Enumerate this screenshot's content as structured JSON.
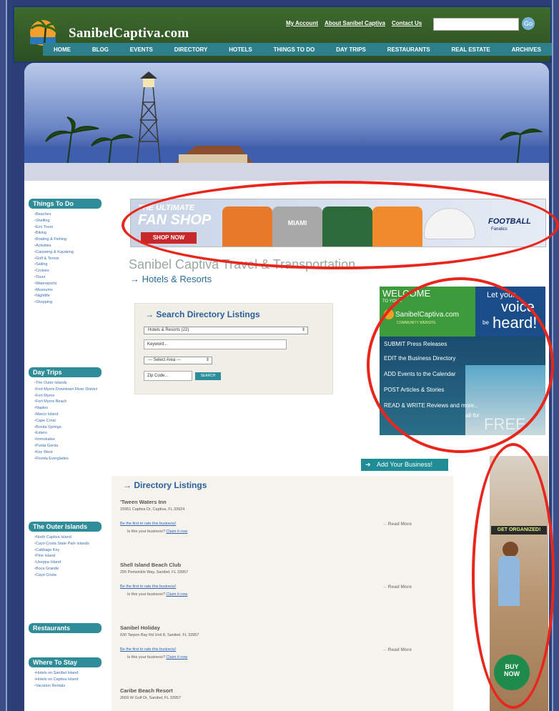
{
  "header": {
    "site_name": "SanibelCaptiva.com",
    "links": [
      "My Account",
      "About Sanibel Captiva",
      "Contact Us"
    ],
    "search_value": "",
    "search_button": "Go"
  },
  "nav": {
    "items": [
      "HOME",
      "BLOG",
      "EVENTS",
      "DIRECTORY",
      "HOTELS",
      "THINGS TO DO",
      "DAY TRIPS",
      "RESTAURANTS",
      "REAL ESTATE",
      "ARCHIVES"
    ]
  },
  "sidebar": {
    "things_to_do": {
      "title": "Things To Do",
      "items": [
        "Beaches",
        "Shelling",
        "Eco Tours",
        "Biking",
        "Boating & Fishing",
        "Activities",
        "Canoeing & Kayaking",
        "Golf & Tennis",
        "Sailing",
        "Cruises",
        "Tours",
        "Watersports",
        "Museums",
        "Nightlife",
        "Shopping"
      ]
    },
    "day_trips": {
      "title": "Day Trips",
      "items": [
        "The Outer Islands",
        "Fort Myers Downtown River District",
        "Fort Myers",
        "Fort Myers Beach",
        "Naples",
        "Marco Island",
        "Cape Coral",
        "Bonita Springs",
        "Estero",
        "Immokalee",
        "Punta Gorda",
        "Key West",
        "Florida Everglades"
      ]
    },
    "outer_islands": {
      "title": "The Outer Islands",
      "items": [
        "North Captiva Island",
        "Cayo Costa State Park Islands",
        "Cabbage Key",
        "Pine Island",
        "Useppa Island",
        "Boca Grande",
        "Cayo Costa"
      ]
    },
    "restaurants": {
      "title": "Restaurants"
    },
    "where_to_stay": {
      "title": "Where To Stay",
      "items": [
        "Hotels on Sanibel Island",
        "Hotels on Captiva Island",
        "Vacation Rentals"
      ]
    }
  },
  "banner_ad": {
    "line1": "THE ULTIMATE",
    "line2": "FAN SHOP",
    "button": "SHOP NOW",
    "brand": "FOOTBALL",
    "brand_sub": "Fanatics",
    "shirt_text": "MIAMI"
  },
  "page": {
    "title": "Sanibel Captiva Travel & Transportation",
    "breadcrumb": "Hotels & Resorts"
  },
  "search_box": {
    "title": "Search Directory Listings",
    "category": "Hotels & Resorts (22)",
    "keyword_placeholder": "Keyword...",
    "area": "--- Select Area ---",
    "zip_placeholder": "Zip Code...",
    "button": "SEARCH"
  },
  "welcome_ad": {
    "welcome": "WELCOME",
    "to_your": "TO YOUR",
    "brand": "SanibelCaptiva.com",
    "brand_sub": "COMMUNITY WEBSITE",
    "let_your": "Let your",
    "voice": "voice",
    "be": "be",
    "heard": "heard!",
    "lines": [
      "SUBMIT Press Releases",
      "EDIT the Business Directory",
      "ADD Events to the Calendar",
      "POST Articles & Stories",
      "READ & WRITE Reviews and more..."
    ],
    "all_for": "all for",
    "free": "FREE"
  },
  "add_business": "Add Your Business!",
  "directory": {
    "title": "Directory Listings",
    "rate_text": "Be the first to rate this business!",
    "claim_text": "Is this your business?",
    "claim_link": "Claim it now",
    "read_more": "Read More",
    "listings": [
      {
        "name": "'Tween Waters Inn",
        "address": "15951 Captiva Dr, Captiva, FL 33924"
      },
      {
        "name": "Shell Island Beach Club",
        "address": "255 Periwinkle Way, Sanibel, FL 33957"
      },
      {
        "name": "Sanibel Holiday",
        "address": "630 Tarpon Bay Rd Unit 8, Sanibel, FL 33957"
      },
      {
        "name": "Caribe Beach Resort",
        "address": "2669 W Gulf Dr, Sanibel, FL 33957"
      }
    ]
  },
  "right_ad": {
    "headline": "GET ORGANIZED!",
    "buy": "BUY",
    "now": "NOW"
  },
  "colors": {
    "header_green": "#2c4f22",
    "nav_teal": "#2e7f8c",
    "highlight_red": "#e8261c",
    "link_blue": "#2a5f9c"
  }
}
